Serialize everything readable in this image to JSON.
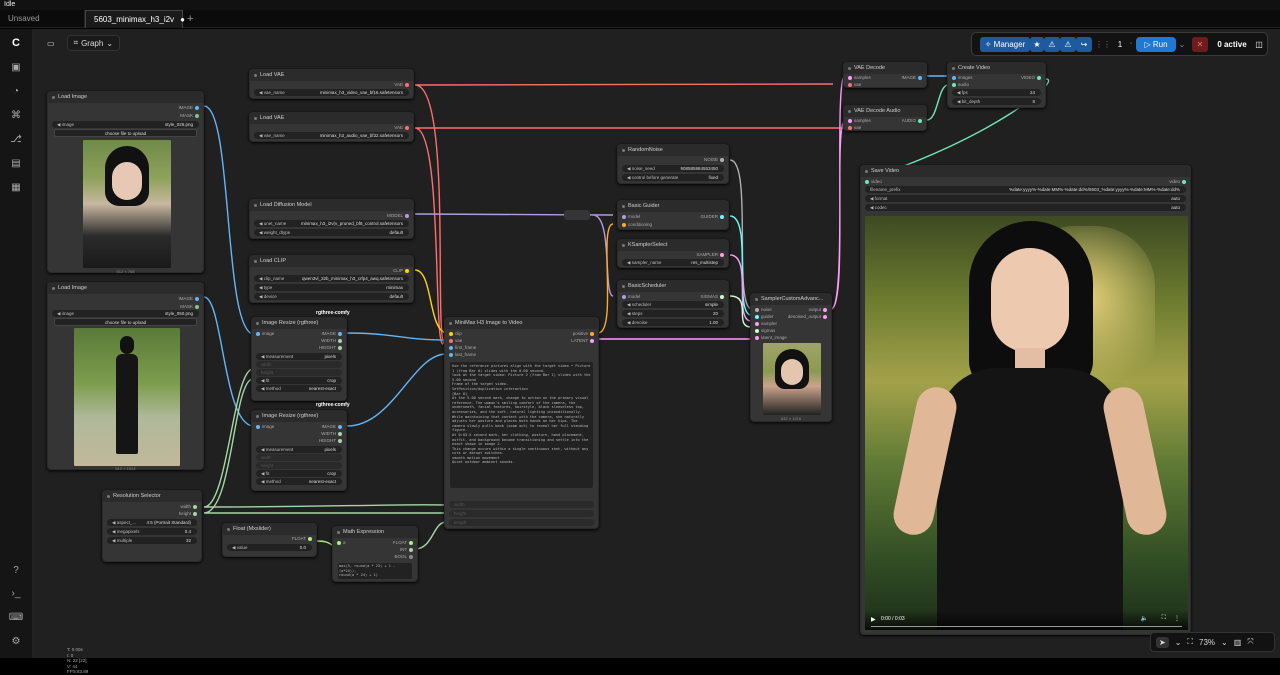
{
  "window_title": "Idle",
  "tabs": [
    {
      "label": "Unsaved Workflow",
      "active": false
    },
    {
      "label": "5603_minimax_h3_i2v",
      "active": true
    }
  ],
  "toolbar": {
    "graph_label": "Graph"
  },
  "runbar": {
    "manager_label": "Manager",
    "queue_count": "1",
    "run_label": "Run",
    "active_label": "0 active"
  },
  "nodes": {
    "load_vae_1": {
      "title": "Load VAE",
      "out": "VAE",
      "widget_label": "vae_name",
      "widget_value": "minimax_h3_video_vae_bf16.safetensors"
    },
    "load_vae_2": {
      "title": "Load VAE",
      "out": "VAE",
      "widget_label": "vae_name",
      "widget_value": "minimax_h3_audio_vae_bf32.safetensors"
    },
    "load_image_1": {
      "title": "Load Image",
      "out1": "IMAGE",
      "out2": "MASK",
      "widget_label": "image",
      "widget_value": "style_026.png",
      "upload": "choose file to upload",
      "caption": "512 × 768"
    },
    "load_image_2": {
      "title": "Load Image",
      "out1": "IMAGE",
      "out2": "MASK",
      "widget_label": "image",
      "widget_value": "style_050.png",
      "upload": "choose file to upload",
      "caption": "512 × 1024"
    },
    "load_diffusion": {
      "title": "Load Diffusion Model",
      "out": "MODEL",
      "w1_label": "unet_name",
      "w1_value": "minimax_h3_i2v(v_pruned_bf8_control.safetensors",
      "w2_label": "weight_dtype",
      "w2_value": "default"
    },
    "load_clip": {
      "title": "Load CLIP",
      "out": "CLIP",
      "w1_label": "clip_name",
      "w1_value": "qwen3vl_32b_minimax_h3_crfp4_awq.safetensors",
      "w2_label": "type",
      "w2_value": "minimax",
      "w3_label": "device",
      "w3_value": "default"
    },
    "resize_1": {
      "group": "rgthree-comfy",
      "title": "Image Resize (rgthree)",
      "in": "image",
      "o1": "IMAGE",
      "o2": "WIDTH",
      "o3": "HEIGHT",
      "w_measure": "measurement",
      "w_measure_v": "pixels",
      "w_width": "width",
      "w_height": "height",
      "w_fit": "fit",
      "w_fit_v": "crop",
      "w_method": "method",
      "w_method_v": "nearest-exact"
    },
    "resize_2": {
      "group": "rgthree-comfy",
      "title": "Image Resize (rgthree)",
      "in": "image",
      "o1": "IMAGE",
      "o2": "WIDTH",
      "o3": "HEIGHT",
      "w_measure": "measurement",
      "w_measure_v": "pixels",
      "w_width": "width",
      "w_height": "height",
      "w_fit": "fit",
      "w_fit_v": "crop",
      "w_method": "method",
      "w_method_v": "nearest-exact"
    },
    "i2v": {
      "title": "MiniMax H3 Image to Video",
      "in1": "clip",
      "in2": "vae",
      "in3": "first_frame",
      "in4": "last_frame",
      "o1": "positive",
      "o2": "LATENT",
      "prompt": "Use the reference pictures align with the target video • Picture 1 (from Bar 0) slides with the 0.00 second.\nlook at the target video: Picture 2 (from Bar 1) slides with the 5.00 second\nFrame of the target video.\nSetPosition/duplication interaction\n[Bar 0]\nAt the 5.00 second mark, change to action on the primary visual reference. The woman's smiling comfort of the camera, the underneath, facial features, hairstyle, black sleeveless top, accessories, and the soft, natural lighting unconditionally.\nWhile maintaining that contact with the camera, she naturally adjusts her posture and places both hands on her hips. The camera slowly pulls back (zoom out) to reveal her full standing figure.\nAt 0:03.5 second mark, her clothing, posture, hand placement, outfit, and background become transitioning and settle into the exact shape in image 2.\nThis change occurs within a single continuous shot, without any cuts or abrupt switches.\nsmooth motion movement\nQuiet outdoor ambient sounds.",
      "w_width": "width",
      "w_height": "height",
      "w_length": "length"
    },
    "random_noise": {
      "title": "RandomNoise",
      "out": "NOISE",
      "w1_label": "noise_seed",
      "w1_value": "908585984553450",
      "w2_label": "control before generate",
      "w2_value": "fixed"
    },
    "basic_guider": {
      "title": "Basic Guider",
      "in1": "model",
      "in2": "conditioning",
      "out": "GUIDER"
    },
    "ksampler_select": {
      "title": "KSamplerSelect",
      "out": "SAMPLER",
      "w_label": "sampler_name",
      "w_value": "res_multistep"
    },
    "basic_scheduler": {
      "title": "BasicScheduler",
      "in": "model",
      "out": "SIGMAS",
      "w1_label": "scheduler",
      "w1_value": "simple",
      "w2_label": "steps",
      "w2_value": "20",
      "w3_label": "denoise",
      "w3_value": "1.00"
    },
    "sampler_custom": {
      "title": "SamplerCustomAdvanc...",
      "in1": "noise",
      "in2": "guider",
      "in3": "sampler",
      "in4": "sigmas",
      "in5": "latent_image",
      "o1": "output",
      "o2": "denoised_output",
      "caption": "832 × 1216"
    },
    "vae_decode": {
      "title": "VAE Decode",
      "in1": "samples",
      "in2": "vae",
      "out": "IMAGE"
    },
    "vae_decode_audio": {
      "title": "VAE Decode Audio",
      "in1": "samples",
      "in2": "vae",
      "out": "AUDIO"
    },
    "create_video": {
      "title": "Create Video",
      "in1": "images",
      "in2": "audio",
      "out": "VIDEO",
      "w1_label": "fps",
      "w1_value": "24",
      "w2_label": "bit_depth",
      "w2_value": "8"
    },
    "save_video": {
      "title": "Save Video",
      "in": "video",
      "out": "video",
      "w1_label": "filename_prefix",
      "w1_value": "%date:yyyy%-%date:MM%-%date:dd%/5603_%date:yyyy%-%date:MM%-%date:dd%",
      "w2_label": "format",
      "w2_value": "auto",
      "w3_label": "codec",
      "w3_value": "auto",
      "time": "0:00 / 0:03"
    },
    "resolution": {
      "title": "Resolution Selector",
      "o1": "width",
      "o2": "height",
      "w1_label": "aspect_...",
      "w1_value": "4:5 (Portrait Standard)",
      "w2_label": "megapixels",
      "w2_value": "0.4",
      "w3_label": "multiple",
      "w3_value": "32"
    },
    "float_node": {
      "title": "Float (Mxslider)",
      "out": "FLOAT",
      "w_label": "value",
      "w_value": "0.0"
    },
    "math_expr": {
      "title": "Math Expression",
      "in": "a",
      "o1": "FLOAT",
      "o2": "INT",
      "o3": "BOOL",
      "expr": "max(5, round(a * 23) + 1 - (a*24)),\nround(a * 24) + 1)"
    }
  },
  "stats": {
    "l1": "T: 0.00s",
    "l2": "I: 0",
    "l3": "N: 22 [22]",
    "l4": "V: 44",
    "l5": "FPS:83.89"
  },
  "bottom": {
    "zoom": "73%"
  },
  "wire_colors": {
    "vae": "#ff6e6e",
    "image": "#64b5f6",
    "model": "#b39ddb",
    "clip": "#ffd500",
    "conditioning": "#ffa931",
    "latent": "#ff9cf9",
    "int": "#a5d6a7",
    "float": "#aaee88",
    "noise": "#b0b0b0",
    "guider": "#66ffff",
    "sigmas": "#cdffcd",
    "audio": "#6ee7b7"
  }
}
